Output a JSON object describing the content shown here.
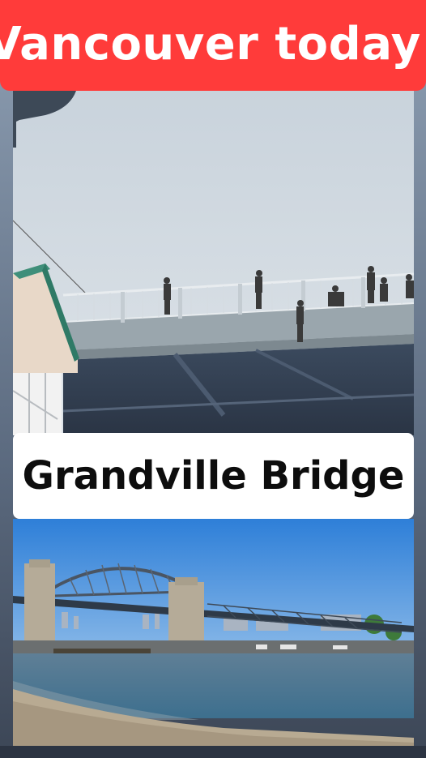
{
  "header": {
    "title": "Vancouver today:"
  },
  "caption": {
    "text": "Grandville Bridge"
  },
  "colors": {
    "title_bg": "#ff3b3a",
    "title_text": "#ffffff",
    "caption_bg": "#ffffff",
    "caption_text": "#0d0d0d"
  },
  "photos": {
    "top": "bridge-deck-underside-photo",
    "bottom": "bridge-from-beach-photo"
  }
}
